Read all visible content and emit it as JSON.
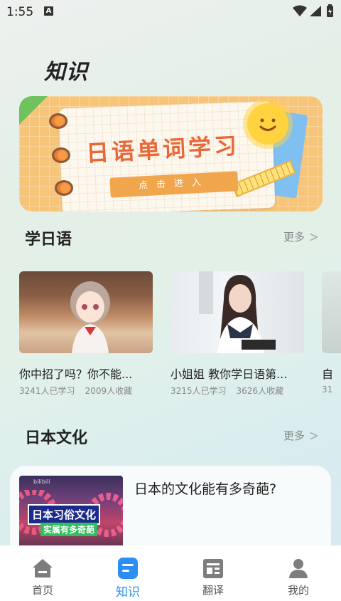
{
  "status_bar": {
    "time": "1:55",
    "notification_glyph": "A"
  },
  "page_title": "知识",
  "banner": {
    "title": "日语单词学习",
    "button": "点击进入"
  },
  "learn_section": {
    "title": "学日语",
    "more": "更多",
    "videos": [
      {
        "title": "你中招了吗？你不能...",
        "learners": "3241人已学习",
        "favorites": "2009人收藏"
      },
      {
        "title": "小姐姐 教你学日语第...",
        "learners": "3215人已学习",
        "favorites": "3626人收藏"
      },
      {
        "title": "自",
        "learners": "31",
        "favorites": ""
      }
    ]
  },
  "culture_section": {
    "title": "日本文化",
    "more": "更多",
    "articles": [
      {
        "title": "日本的文化能有多奇葩?",
        "thumb_tag": "日本习俗文化",
        "thumb_subtag": "实属有多奇葩",
        "thumb_logo": "bilibili"
      }
    ]
  },
  "tab_bar": {
    "active_color": "#2c8ef2",
    "inactive_color": "#555555",
    "tabs": [
      {
        "label": "首页",
        "icon": "home-icon"
      },
      {
        "label": "知识",
        "icon": "knowledge-icon"
      },
      {
        "label": "翻译",
        "icon": "translate-icon"
      },
      {
        "label": "我的",
        "icon": "profile-icon"
      }
    ]
  }
}
